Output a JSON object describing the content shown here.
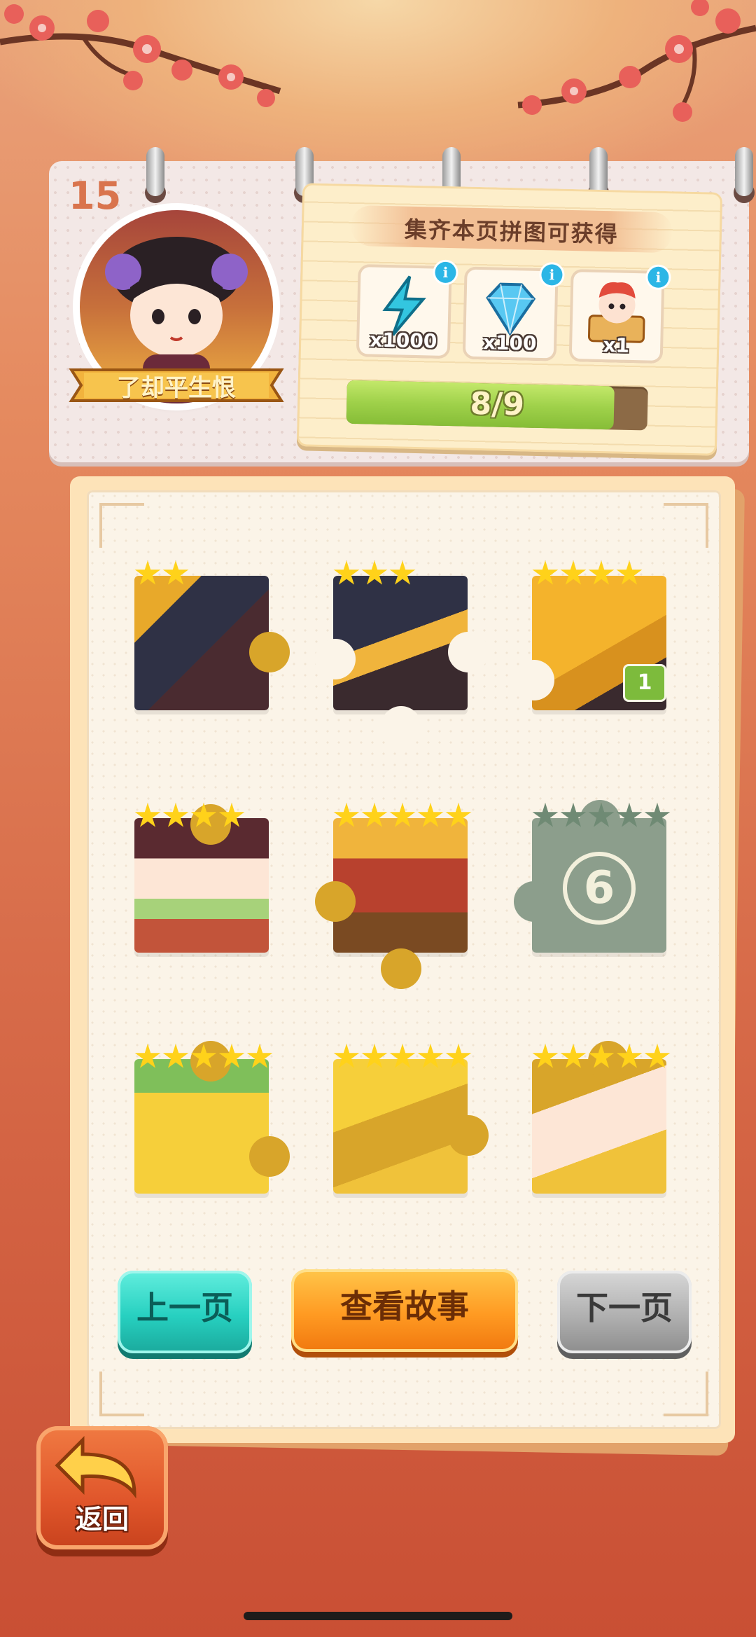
{
  "header": {
    "page_number": "15",
    "chapter_title": "了却平生恨"
  },
  "reward_panel": {
    "title": "集齐本页拼图可获得",
    "rewards": [
      {
        "icon": "lightning-energy-icon",
        "count": "x1000"
      },
      {
        "icon": "blue-diamond-icon",
        "count": "x100"
      },
      {
        "icon": "jester-avatar-icon",
        "count": "x1"
      }
    ],
    "progress_text": "8/9",
    "progress_fraction": 0.889
  },
  "pieces": [
    {
      "stars": 2,
      "locked": false
    },
    {
      "stars": 3,
      "locked": false
    },
    {
      "stars": 4,
      "locked": false,
      "badge": "1"
    },
    {
      "stars": 4,
      "locked": false
    },
    {
      "stars": 5,
      "locked": false
    },
    {
      "stars": 5,
      "locked": true,
      "number": "6"
    },
    {
      "stars": 5,
      "locked": false
    },
    {
      "stars": 5,
      "locked": false
    },
    {
      "stars": 5,
      "locked": false
    }
  ],
  "buttons": {
    "prev": "上一页",
    "story": "查看故事",
    "next": "下一页",
    "back": "返回"
  },
  "colors": {
    "star_gold": "#ffd21a",
    "star_locked": "#6f8a74",
    "locked_piece": "#8c9e8c",
    "badge_green": "#7dbb3c"
  }
}
